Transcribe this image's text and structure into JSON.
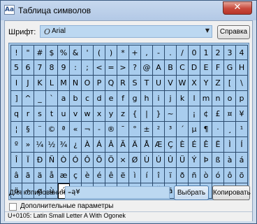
{
  "window": {
    "title": "Таблица символов",
    "close_symbol": "✕",
    "app_icon": "character-map-icon",
    "app_icon_glyph": "Aa"
  },
  "font_row": {
    "label": "Шрифт:",
    "font_type_symbol": "O",
    "font_name": "Arial",
    "dropdown_symbol": "▼",
    "help_button": "Справка"
  },
  "grid": {
    "selected_index": 184,
    "rows": [
      [
        "!",
        "\"",
        "#",
        "$",
        "%",
        "&",
        "'",
        "(",
        ")",
        "*",
        "+",
        ",",
        "-",
        ".",
        "/",
        "0",
        "1",
        "2",
        "3",
        "4"
      ],
      [
        "5",
        "6",
        "7",
        "8",
        "9",
        ":",
        ";",
        "<",
        "=",
        ">",
        "?",
        "@",
        "A",
        "B",
        "C",
        "D",
        "E",
        "F",
        "G",
        "H"
      ],
      [
        "I",
        "J",
        "K",
        "L",
        "M",
        "N",
        "O",
        "P",
        "Q",
        "R",
        "S",
        "T",
        "U",
        "V",
        "W",
        "X",
        "Y",
        "Z",
        "[",
        "\\"
      ],
      [
        "]",
        "^",
        "_",
        "`",
        "a",
        "b",
        "c",
        "d",
        "e",
        "f",
        "g",
        "h",
        "i",
        "j",
        "k",
        "l",
        "m",
        "n",
        "o",
        "p"
      ],
      [
        "q",
        "r",
        "s",
        "t",
        "u",
        "v",
        "w",
        "x",
        "y",
        "z",
        "{",
        "|",
        "}",
        "~",
        " ",
        "¡",
        "¢",
        "£",
        "¤",
        "¥"
      ],
      [
        "¦",
        "§",
        "¨",
        "©",
        "ª",
        "«",
        "¬",
        "-",
        "®",
        "¯",
        "°",
        "±",
        "²",
        "³",
        "´",
        "µ",
        "¶",
        "·",
        "¸",
        "¹"
      ],
      [
        "º",
        "»",
        "¼",
        "½",
        "¾",
        "¿",
        "À",
        "Á",
        "Â",
        "Ã",
        "Ä",
        "Å",
        "Æ",
        "Ç",
        "È",
        "É",
        "Ê",
        "Ë",
        "Ì",
        "Í"
      ],
      [
        "Î",
        "Ï",
        "Ð",
        "Ñ",
        "Ò",
        "Ó",
        "Ô",
        "Õ",
        "Ö",
        "×",
        "Ø",
        "Ù",
        "Ú",
        "Û",
        "Ü",
        "Ý",
        "Þ",
        "ß",
        "à",
        "á"
      ],
      [
        "â",
        "ã",
        "ä",
        "å",
        "æ",
        "ç",
        "è",
        "é",
        "ê",
        "ë",
        "ì",
        "í",
        "î",
        "ï",
        "ð",
        "ñ",
        "ò",
        "ó",
        "ô",
        "õ"
      ],
      [
        "ö",
        "÷",
        "ø",
        "ù",
        "ú",
        "û",
        "ü",
        "ý",
        "þ",
        "ÿ",
        "Ā",
        "ā",
        "Ă",
        "ă",
        "Ą",
        "ą",
        "Ć",
        "ć",
        "Ĉ",
        "ĉ"
      ]
    ]
  },
  "copy_row": {
    "label": "Для копирования:",
    "value": "₌ą¥",
    "select_button": "Выбрать",
    "copy_button": "Копировать"
  },
  "advanced": {
    "label": "Дополнительные параметры",
    "checked": false
  },
  "status": {
    "text": "U+0105: Latin Small Letter A With Ogonek"
  }
}
